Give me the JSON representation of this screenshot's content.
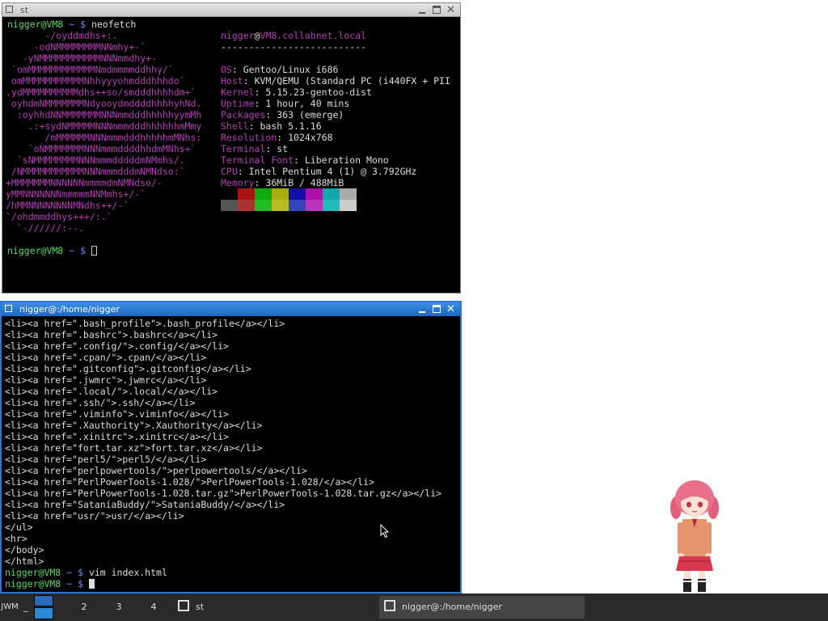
{
  "window1": {
    "title": "st",
    "prompt_user": "nigger@VM8",
    "prompt_dir": "~",
    "prompt_sym": "$",
    "command": "neofetch"
  },
  "neofetch": {
    "header_user": "nigger",
    "header_at": "@",
    "header_host": "VM8.collabnet.local",
    "separator": "--------------------------",
    "info": [
      {
        "key": "OS",
        "value": "Gentoo/Linux i686"
      },
      {
        "key": "Host",
        "value": "KVM/QEMU (Standard PC (i440FX + PII"
      },
      {
        "key": "Kernel",
        "value": "5.15.23-gentoo-dist"
      },
      {
        "key": "Uptime",
        "value": "1 hour, 40 mins"
      },
      {
        "key": "Packages",
        "value": "363 (emerge)"
      },
      {
        "key": "Shell",
        "value": "bash 5.1.16"
      },
      {
        "key": "Resolution",
        "value": "1024x768"
      },
      {
        "key": "Terminal",
        "value": "st"
      },
      {
        "key": "Terminal Font",
        "value": "Liberation Mono"
      },
      {
        "key": "CPU",
        "value": "Intel Pentium 4 (1) @ 3.792GHz"
      },
      {
        "key": "Memory",
        "value": "36MiB / 488MiB"
      }
    ],
    "ascii": [
      "       -/oyddmdhs+:.",
      "     -odNMMMMMMMMNNmhy+-`",
      "   -yNMMMMMMMMMMMNNNmmdhy+-",
      " `omMMMMMMMMMMMMNmdmmmmddhhy/`",
      " omMMMMMMMMMMMNhhyyyohmdddhhhdo`",
      ".ydMMMMMMMMMMdhs++so/smdddhhhhdm+`",
      " oyhdmNMMMMMMMNdyooydmddddhhhhyhNd.",
      "  :oyhhdNNMMMMMMMNNNmmdddhhhhhyymMh",
      "    .:+sydNMMMMMNNNmmmdddhhhhhhmMmy",
      "       /mMMMMMMNNNmmmdddhhhhhmMNhs:",
      "    `oNMMMMMMMNNNmmmddddhhdmMNhs+`",
      "  `sNMMMMMMMMNNNmmmdddddmNMmhs/.",
      " /NMMMMMMMMMMMNNNmmmdddmNMNdso:`",
      "+MMMMMMMNNNNNNmmmmdmNMNdso/-",
      "yMMNNNNNNNmmmmmNNMmhs+/-`",
      "/hMMNNNNNNNNMNdhs++/-`",
      "`/ohdmmddhys+++/:.`",
      "  `-//////:--."
    ],
    "palette_top": [
      "#000000",
      "#aa1111",
      "#11aa11",
      "#aaaa11",
      "#1111aa",
      "#aa11aa",
      "#11aaaa",
      "#aaaaaa"
    ],
    "palette_bottom": [
      "#555555",
      "#aa3333",
      "#22bb22",
      "#bbbb22",
      "#3344bb",
      "#bb33bb",
      "#22bbbb",
      "#cccccc"
    ]
  },
  "window2": {
    "title": "nigger@:/home/nigger",
    "lines": [
      "<li><a href=\".bash_profile\">.bash_profile</a></li>",
      "<li><a href=\".bashrc\">.bashrc</a></li>",
      "<li><a href=\".config/\">.config/</a></li>",
      "<li><a href=\".cpan/\">.cpan/</a></li>",
      "<li><a href=\".gitconfig\">.gitconfig</a></li>",
      "<li><a href=\".jwmrc\">.jwmrc</a></li>",
      "<li><a href=\".local/\">.local/</a></li>",
      "<li><a href=\".ssh/\">.ssh/</a></li>",
      "<li><a href=\".viminfo\">.viminfo</a></li>",
      "<li><a href=\".Xauthority\">.Xauthority</a></li>",
      "<li><a href=\".xinitrc\">.xinitrc</a></li>",
      "<li><a href=\"fort.tar.xz\">fort.tar.xz</a></li>",
      "<li><a href=\"perl5/\">perl5/</a></li>",
      "<li><a href=\"perlpowertools/\">perlpowertools/</a></li>",
      "<li><a href=\"PerlPowerTools-1.028/\">PerlPowerTools-1.028/</a></li>",
      "<li><a href=\"PerlPowerTools-1.028.tar.gz\">PerlPowerTools-1.028.tar.gz</a></li>",
      "<li><a href=\"SataniaBuddy/\">SataniaBuddy/</a></li>",
      "<li><a href=\"usr/\">usr/</a></li>",
      "</ul>",
      "<hr>",
      "</body>",
      "</html>"
    ],
    "prompt_user": "nigger@VM8",
    "prompt_dir": "~",
    "prompt_sym": "$",
    "command": "vim index.html"
  },
  "taskbar": {
    "menu_label": "JWM",
    "dash": "_",
    "workspaces": [
      "2",
      "3",
      "4"
    ],
    "tasks": [
      "st",
      "nigger@:/home/nigger"
    ]
  }
}
